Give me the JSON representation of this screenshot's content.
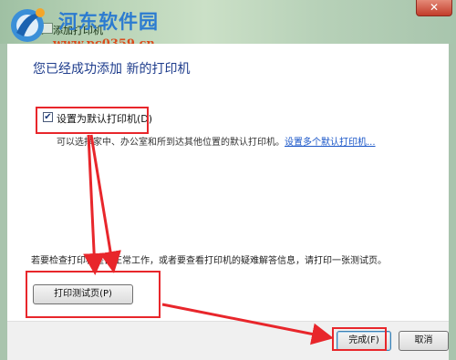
{
  "titlebar": {
    "title": "添加打印机",
    "close_label": "✕"
  },
  "watermark": {
    "name": "河东软件园",
    "url": "www.pc0359.cn"
  },
  "content": {
    "heading": "您已经成功添加 新的打印机",
    "default_checkbox": {
      "label": "设置为默认打印机(D)",
      "checked": true,
      "mark": "✔"
    },
    "description": "可以选择家中、办公室和所到达其他位置的默认打印机。",
    "description_link": "设置多个默认打印机...",
    "test_prompt": "若要检查打印机是否正常工作，或者要查看打印机的疑难解答信息，请打印一张测试页。",
    "test_button": "打印测试页(P)"
  },
  "footer": {
    "finish_button": "完成(F)",
    "cancel_button": "取消"
  },
  "colors": {
    "annotation": "#e8262b",
    "heading": "#1e3c8c",
    "link": "#1a56c8"
  }
}
